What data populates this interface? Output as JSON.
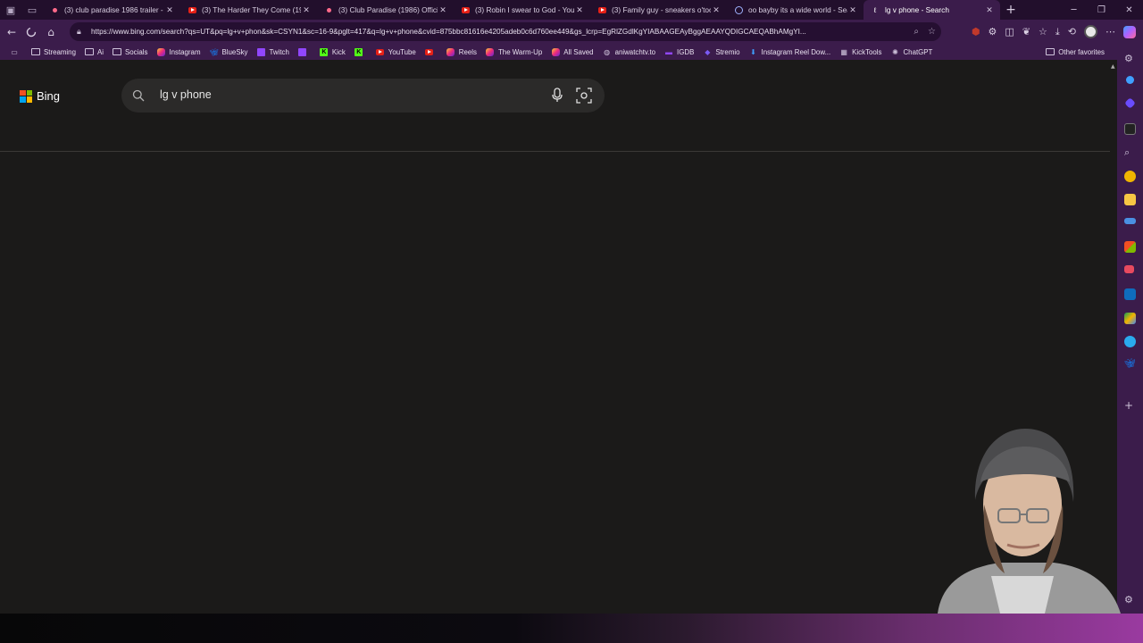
{
  "tabs": [
    {
      "title": "(3) club paradise 1986 trailer - Y",
      "icon": "youtube-icon",
      "active": false
    },
    {
      "title": "(3) The Harder They Come (197",
      "icon": "youtube-icon",
      "active": false
    },
    {
      "title": "(3) Club Paradise (1986) Official",
      "icon": "youtube-icon",
      "active": false
    },
    {
      "title": "(3) Robin I swear to God - YouTu",
      "icon": "youtube-icon",
      "active": false
    },
    {
      "title": "(3) Family guy - sneakers o'tool",
      "icon": "youtube-icon",
      "active": false
    },
    {
      "title": "oo bayby its a wide world - Sear",
      "icon": "search-icon",
      "active": false
    },
    {
      "title": "lg v phone - Search",
      "icon": "bing-icon",
      "active": true
    }
  ],
  "address_bar": {
    "url": "https://www.bing.com/search?qs=UT&pq=lg+v+phon&sk=CSYN1&sc=16-9&pglt=417&q=lg+v+phone&cvid=875bbc81616e4205adeb0c6d760ee449&gs_lcrp=EgRlZGdlKgYIABAAGEAyBggAEAAYQDIGCAEQABhAMgYI..."
  },
  "bookmarks": [
    {
      "label": "Streaming",
      "icon": "folder-icon"
    },
    {
      "label": "Ai",
      "icon": "folder-icon"
    },
    {
      "label": "Socials",
      "icon": "folder-icon"
    },
    {
      "label": "Instagram",
      "icon": "instagram-icon"
    },
    {
      "label": "BlueSky",
      "icon": "bluesky-icon"
    },
    {
      "label": "Twitch",
      "icon": "twitch-icon"
    },
    {
      "label": "",
      "icon": "twitch-icon"
    },
    {
      "label": "Kick",
      "icon": "kick-icon"
    },
    {
      "label": "",
      "icon": "kick-icon"
    },
    {
      "label": "YouTube",
      "icon": "youtube-icon"
    },
    {
      "label": "",
      "icon": "youtube-icon"
    },
    {
      "label": "Reels",
      "icon": "instagram-icon"
    },
    {
      "label": "The Warm-Up",
      "icon": "instagram-icon"
    },
    {
      "label": "All Saved",
      "icon": "instagram-icon"
    },
    {
      "label": "aniwatchtv.to",
      "icon": "globe-icon"
    },
    {
      "label": "IGDB",
      "icon": "igdb-icon"
    },
    {
      "label": "Stremio",
      "icon": "stremio-icon"
    },
    {
      "label": "Instagram Reel Dow...",
      "icon": "download-icon"
    },
    {
      "label": "KickTools",
      "icon": "kick-icon"
    },
    {
      "label": "ChatGPT",
      "icon": "chatgpt-icon"
    }
  ],
  "other_favorites": "Other favorites",
  "bing": {
    "logo_text": "Bing",
    "query": "lg v phone"
  },
  "colors": {
    "browser_chrome": "#3b1c4b",
    "page_background": "#1b1a19",
    "search_box": "#2b2a29"
  }
}
